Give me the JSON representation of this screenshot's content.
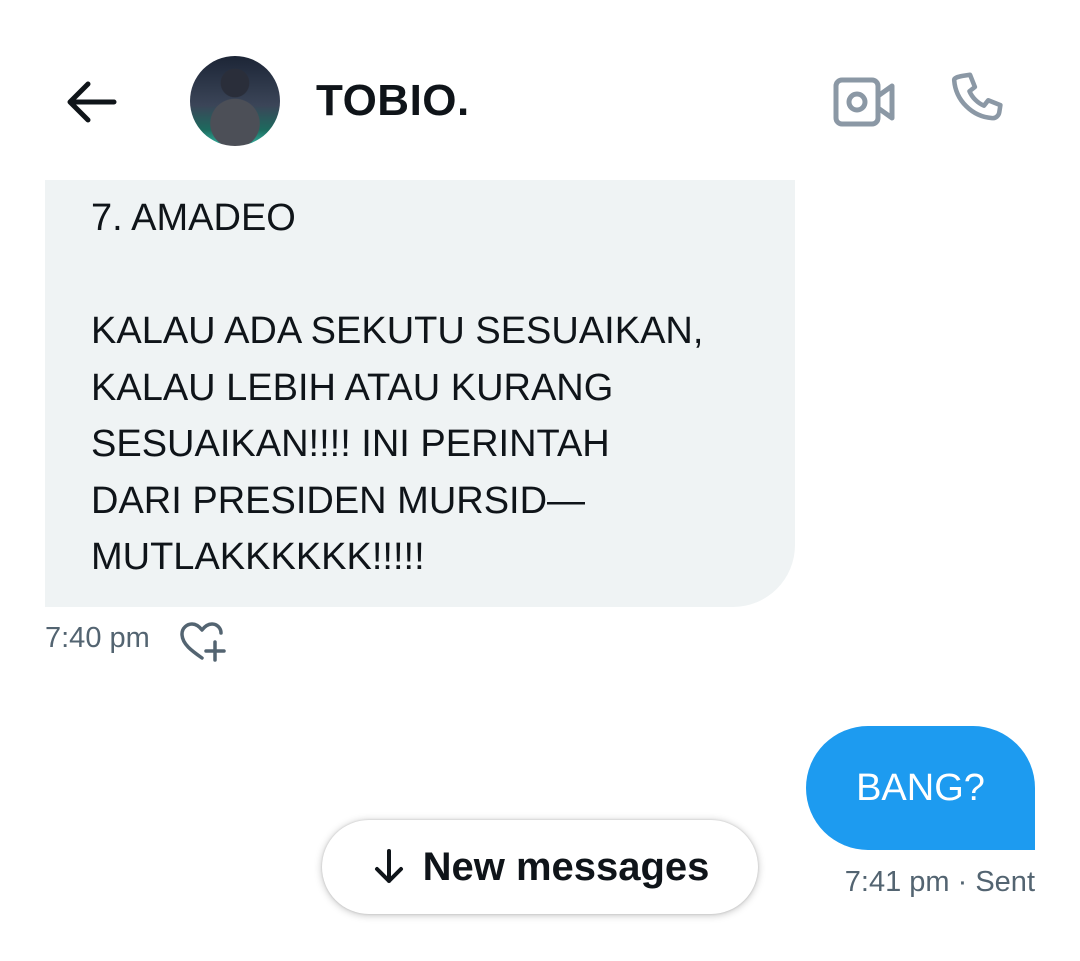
{
  "header": {
    "title": "TOBIO.",
    "back_icon": "arrow-left-icon",
    "video_icon": "video-call-icon",
    "call_icon": "phone-icon"
  },
  "messages": {
    "incoming": {
      "lines": [
        "7. AMADEO",
        "",
        "KALAU ADA SEKUTU SESUAIKAN,",
        "KALAU LEBIH ATAU KURANG",
        "SESUAIKAN!!!! INI PERINTAH",
        "DARI PRESIDEN MURSID—",
        "MUTLAKKKKKK!!!!!"
      ],
      "time": "7:40 pm",
      "reaction_icon": "heart-plus-icon"
    },
    "outgoing": {
      "text": "BANG?",
      "meta": "7:41 pm · Sent"
    }
  },
  "new_messages_button": {
    "label": "New messages",
    "icon": "arrow-down-icon"
  },
  "colors": {
    "incoming_bubble": "#eff3f4",
    "outgoing_bubble": "#1d9bf0",
    "secondary_text": "#536471",
    "primary_text": "#0f1419"
  }
}
